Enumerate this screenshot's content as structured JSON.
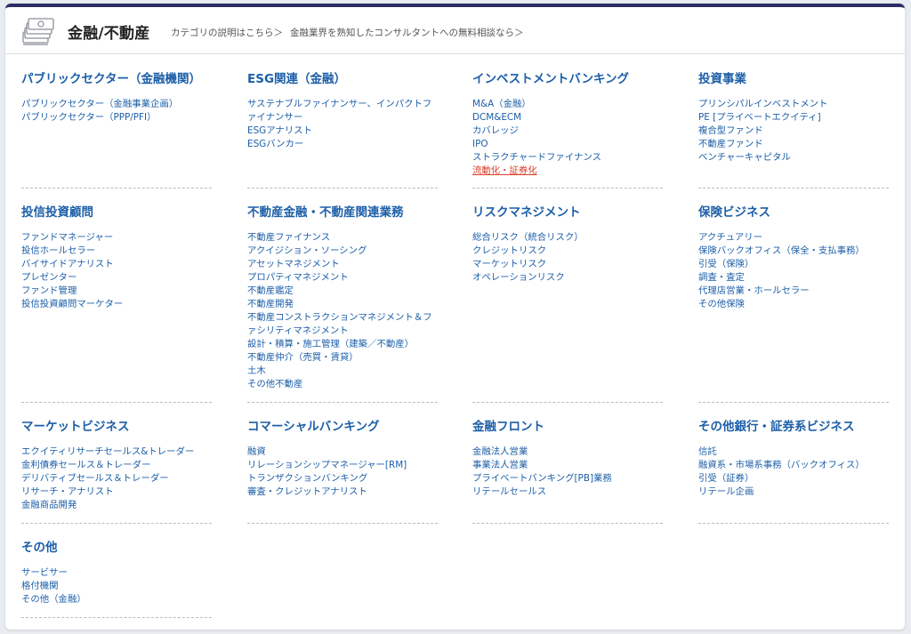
{
  "header": {
    "title": "金融/不動産",
    "links": [
      "カテゴリの説明はこちら＞",
      "金融業界を熟知したコンサルタントへの無料相談なら＞"
    ]
  },
  "sections": [
    {
      "title": "パブリックセクター（金融機関）",
      "items": [
        "パブリックセクター（金融事業企画）",
        "パブリックセクター（PPP/PFI）"
      ]
    },
    {
      "title": "ESG関連（金融）",
      "items": [
        "サステナブルファイナンサー、インパクトファイナンサー",
        "ESGアナリスト",
        "ESGバンカー"
      ]
    },
    {
      "title": "インベストメントバンキング",
      "items": [
        "M&A（金融）",
        "DCM&ECM",
        "カバレッジ",
        "IPO",
        "ストラクチャードファイナンス",
        "流動化・証券化"
      ],
      "active_index": 5
    },
    {
      "title": "投資事業",
      "items": [
        "プリンシパルインベストメント",
        "PE [プライベートエクイティ]",
        "複合型ファンド",
        "不動産ファンド",
        "ベンチャーキャピタル"
      ]
    },
    {
      "title": "投信投資顧問",
      "items": [
        "ファンドマネージャー",
        "投信ホールセラー",
        "バイサイドアナリスト",
        "プレゼンター",
        "ファンド管理",
        "投信投資顧問マーケター"
      ]
    },
    {
      "title": "不動産金融・不動産関連業務",
      "items": [
        "不動産ファイナンス",
        "アクイジション・ソーシング",
        "アセットマネジメント",
        "プロパティマネジメント",
        "不動産鑑定",
        "不動産開発",
        "不動産コンストラクションマネジメント＆ファシリティマネジメント",
        "設計・積算・施工管理（建築／不動産）",
        "不動産仲介（売買・賃貸）",
        "土木",
        "その他不動産"
      ]
    },
    {
      "title": "リスクマネジメント",
      "items": [
        "総合リスク（統合リスク）",
        "クレジットリスク",
        "マーケットリスク",
        "オペレーションリスク"
      ]
    },
    {
      "title": "保険ビジネス",
      "items": [
        "アクチュアリー",
        "保険バックオフィス（保全・支払事務）",
        "引受（保険）",
        "調査・査定",
        "代理店営業・ホールセラー",
        "その他保険"
      ]
    },
    {
      "title": "マーケットビジネス",
      "items": [
        "エクイティリサーチセールス&トレーダー",
        "金利債券セールス＆トレーダー",
        "デリバティブセールス＆トレーダー",
        "リサーチ・アナリスト",
        "金融商品開発"
      ]
    },
    {
      "title": "コマーシャルバンキング",
      "items": [
        "融資",
        "リレーションシップマネージャー[RM]",
        "トランザクションバンキング",
        "審査・クレジットアナリスト"
      ]
    },
    {
      "title": "金融フロント",
      "items": [
        "金融法人営業",
        "事業法人営業",
        "プライベートバンキング[PB]業務",
        "リテールセールス"
      ]
    },
    {
      "title": "その他銀行・証券系ビジネス",
      "items": [
        "信託",
        "融資系・市場系事務（バックオフィス）",
        "引受（証券）",
        "リテール企画"
      ]
    },
    {
      "title": "その他",
      "items": [
        "サービサー",
        "格付機関",
        "その他（金融）"
      ]
    }
  ]
}
